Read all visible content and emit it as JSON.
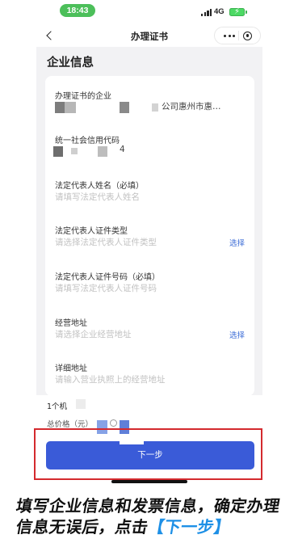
{
  "status_bar": {
    "time": "18:43",
    "network": "4G"
  },
  "nav": {
    "title": "办理证书"
  },
  "section_title": "企业信息",
  "fields": [
    {
      "label": "办理证书的企业",
      "value": "公司惠州市惠…"
    },
    {
      "label": "统一社会信用代码",
      "value": "4"
    },
    {
      "label": "法定代表人姓名（必填）",
      "placeholder": "请填写法定代表人姓名"
    },
    {
      "label": "法定代表人证件类型",
      "placeholder": "请选择法定代表人证件类型",
      "action": "选择"
    },
    {
      "label": "法定代表人证件号码（必填）",
      "placeholder": "请填写法定代表人证件号码"
    },
    {
      "label": "经营地址",
      "placeholder": "请选择企业经营地址",
      "action": "选择"
    },
    {
      "label": "详细地址",
      "placeholder": "请输入营业执照上的经营地址"
    }
  ],
  "summary": {
    "count_label": "1个机",
    "price_label": "总价格（元）"
  },
  "next_button": {
    "label": "下一步"
  },
  "caption": {
    "line1": "填写企业信息和发票信息，确定办理",
    "line2_prefix": "信息无误后，点击",
    "line2_highlight": "【下一步】"
  },
  "colors": {
    "accent": "#3a5bd8",
    "link": "#3a6bd6",
    "caption_highlight": "#1e90e6",
    "outline": "#d42a2e",
    "time_pill": "#4cbf5a"
  },
  "icons": [
    "back-chevron-icon",
    "more-icon",
    "target-icon",
    "signal-icon",
    "battery-icon"
  ]
}
